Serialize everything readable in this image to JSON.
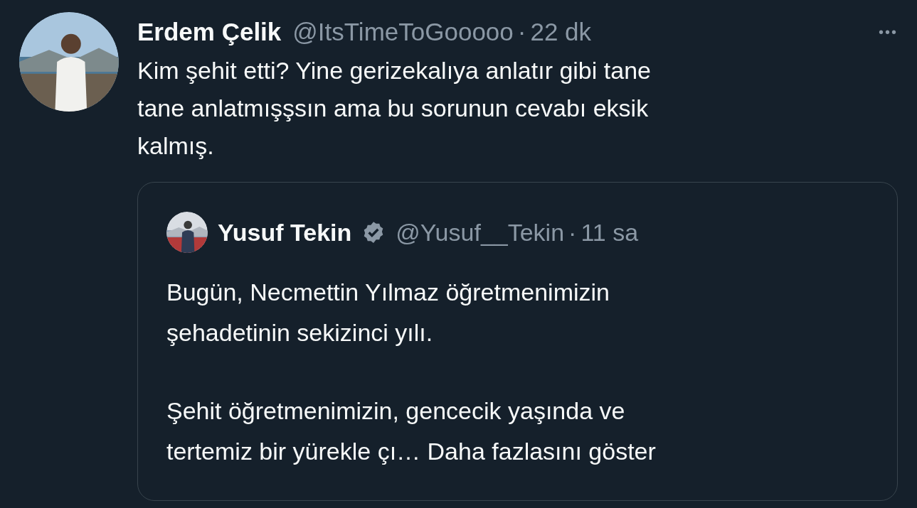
{
  "tweet": {
    "author": "Erdem Çelik",
    "handle": "@ItsTimeToGooooo",
    "separator": "·",
    "time": "22 dk",
    "more": "•••",
    "text": "Kim şehit etti? Yine gerizekalıya anlatır gibi tane\ntane anlatmışşsın ama bu sorunun cevabı eksik\nkalmış.",
    "quote": {
      "author": "Yusuf Tekin",
      "verified": true,
      "handle": "@Yusuf__Tekin",
      "separator": "·",
      "time": "11 sa",
      "paragraphs": [
        "Bugün, Necmettin Yılmaz öğretmenimizin\nşehadetinin sekizinci yılı.",
        "Şehit öğretmenimizin, gencecik yaşında ve\ntertemiz bir yürekle çı…"
      ],
      "show_more": "Daha fazlasını göster"
    }
  }
}
